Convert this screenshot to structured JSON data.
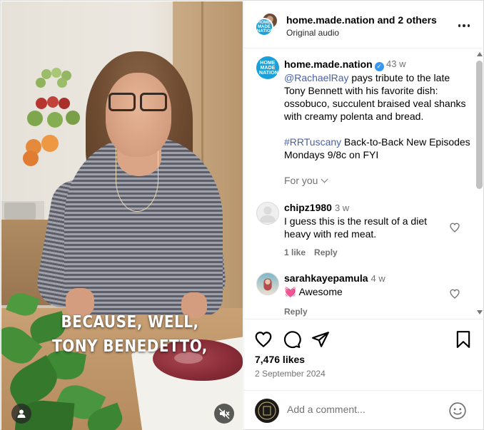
{
  "video": {
    "caption_line1": "BECAUSE, WELL,",
    "caption_line2": "TONY BENEDETTO,"
  },
  "header": {
    "username": "home.made.nation",
    "others": "and 2 others",
    "audio": "Original audio",
    "avatar_text": "HOME MADE NATION"
  },
  "post_caption": {
    "username": "home.made.nation",
    "age": "43 w",
    "mention": "@RachaelRay",
    "text1": " pays tribute to the late Tony Bennett with his favorite dish: ossobuco, succulent braised veal shanks with creamy polenta and bread.",
    "hashtag": "#RRTuscany",
    "text2": " Back-to-Back New Episodes Mondays 9/8c on FYI",
    "for_you": "For you"
  },
  "comments": [
    {
      "username": "chipz1980",
      "age": "3 w",
      "text": "I guess this is the result of a diet heavy with red meat.",
      "likes": "1 like",
      "reply": "Reply"
    },
    {
      "username": "sarahkayepamula",
      "age": "4 w",
      "emoji": "💓",
      "text": "Awesome",
      "reply": "Reply"
    }
  ],
  "footer": {
    "likes": "7,476 likes",
    "date": "2 September 2024",
    "add_comment_placeholder": "Add a comment..."
  },
  "colors": {
    "brand_blue": "#1a9fd9",
    "verified_blue": "#3897f0",
    "mention_blue": "#4661a9",
    "muted_text": "#737373"
  },
  "icons": [
    "heart-icon",
    "comment-icon",
    "share-icon",
    "bookmark-icon",
    "more-icon",
    "verified-icon",
    "chevron-down-icon",
    "emoji-icon",
    "mute-icon",
    "user-tag-icon"
  ]
}
